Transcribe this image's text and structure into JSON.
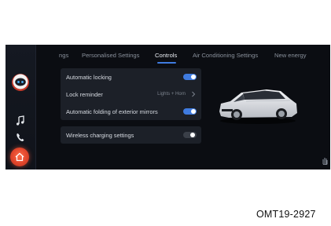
{
  "tabs": [
    {
      "label": "ngs",
      "active": false
    },
    {
      "label": "Personalised Settings",
      "active": false
    },
    {
      "label": "Controls",
      "active": true
    },
    {
      "label": "Air Conditioning Settings",
      "active": false
    },
    {
      "label": "New energy",
      "active": false
    }
  ],
  "settings": {
    "automatic_locking": {
      "label": "Automatic locking",
      "state": "on"
    },
    "lock_reminder": {
      "label": "Lock reminder",
      "value": "Lights + Horn"
    },
    "mirror_folding": {
      "label": "Automatic folding of exterior mirrors",
      "state": "on"
    },
    "wireless_charging": {
      "label": "Wireless charging settings",
      "state": "off"
    }
  },
  "sidebar": {
    "icons": [
      "assistant-icon",
      "music-icon",
      "phone-icon",
      "home-icon"
    ]
  },
  "colors": {
    "accent": "#3f7be0",
    "home_button": "#e0452b",
    "screen_bg": "#0b0d12",
    "panel_bg": "#1c2028"
  },
  "figure_code": "OMT19-2927"
}
